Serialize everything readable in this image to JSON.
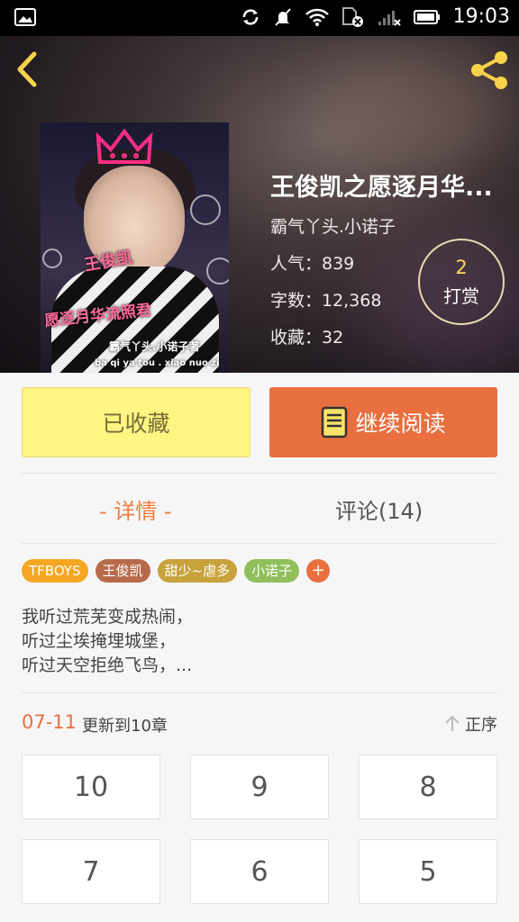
{
  "status_bar": {
    "time": "19:03"
  },
  "book": {
    "title": "王俊凯之愿逐月华...",
    "author": "霸气丫头.小诺子",
    "popularity": "人气：839",
    "word_count": "字数：12,368",
    "favorites": "收藏：32",
    "cover": {
      "line1": "王俊凯",
      "line2": "愿逐月华流照君",
      "line3": "霸气丫头.小诺子著",
      "line4": "ba qi ya tou . xiao nuo zi"
    }
  },
  "reward": {
    "count": "2",
    "label": "打赏"
  },
  "actions": {
    "collect_label": "已收藏",
    "read_label": "继续阅读"
  },
  "tabs": {
    "details": "- 详情 -",
    "comments": "评论(14)"
  },
  "tags": [
    {
      "label": "TFBOYS",
      "color": "#f5a623"
    },
    {
      "label": "王俊凯",
      "color": "#b86b4b"
    },
    {
      "label": "甜少~虐多",
      "color": "#c8a23a"
    },
    {
      "label": "小诺子",
      "color": "#8fbf5a"
    }
  ],
  "tag_add": "+",
  "summary": [
    "我听过荒芜变成热闹，",
    "听过尘埃掩埋城堡，",
    "听过天空拒绝飞鸟，..."
  ],
  "update": {
    "date": "07-11",
    "text": "更新到10章"
  },
  "sort_label": "正序",
  "chapters": [
    "10",
    "9",
    "8",
    "7",
    "6",
    "5"
  ],
  "colors": {
    "accent": "#e96f3f",
    "collect_bg": "#fff582",
    "tab_active": "#ee7d43"
  }
}
